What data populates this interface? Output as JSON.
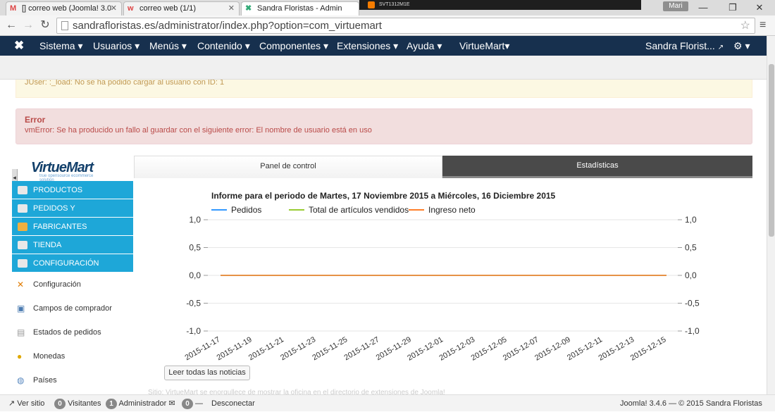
{
  "browser": {
    "tabs": [
      {
        "label": "[] correo web (Joomla! 3.0",
        "icon": "gmail-icon"
      },
      {
        "label": "correo web (1/1)",
        "icon": "webmail-icon"
      },
      {
        "label": "Sandra Floristas - Admin",
        "icon": "joomla-icon"
      }
    ],
    "taskbar_label": "SVT1312M1E",
    "profile": "Mari",
    "url": "sandrafloristas.es/administrator/index.php?option=com_virtuemart"
  },
  "joomla_bar": {
    "logo": "joomla-logo",
    "menu": [
      "Sistema",
      "Usuarios",
      "Menús",
      "Contenido",
      "Componentes",
      "Extensiones",
      "Ayuda",
      "VirtueMart"
    ],
    "site": "Sandra Florist...",
    "settings": "gear-icon"
  },
  "messages": {
    "warning_text": "JUser: :_load: No se ha podido cargar al usuario con ID: 1",
    "error_title": "Error",
    "error_text": "vmError: Se ha producido un fallo al guardar con el siguiente error: El nombre de usuario está en uso"
  },
  "sidebar": {
    "logo": "VirtueMart",
    "logo_tag": "true opensource ecommerce solution",
    "sections": [
      {
        "label": "PRODUCTOS",
        "icon": "products-icon"
      },
      {
        "label": "PEDIDOS Y",
        "icon": "orders-icon"
      },
      {
        "label": "FABRICANTES",
        "icon": "wrench-icon"
      },
      {
        "label": "TIENDA",
        "icon": "shop-icon"
      },
      {
        "label": "CONFIGURACIÓN",
        "icon": "config-icon"
      }
    ],
    "sub_items": [
      {
        "label": "Configuración",
        "icon": "tools-icon"
      },
      {
        "label": "Campos de comprador",
        "icon": "fields-icon"
      },
      {
        "label": "Estados de pedidos",
        "icon": "document-icon"
      },
      {
        "label": "Monedas",
        "icon": "coins-icon"
      },
      {
        "label": "Países",
        "icon": "globe-icon"
      }
    ]
  },
  "panel": {
    "tabs": [
      "Panel de control",
      "Estadísticas"
    ],
    "news_button": "Leer todas las noticias",
    "faint_text": "Sitio: VirtueMart se enorgullece de mostrar la oficina en el directorio de extensiones de Joomla!"
  },
  "chart_data": {
    "type": "line",
    "title": "Informe para el periodo de Martes, 17 Noviembre 2015 a Miércoles, 16 Diciembre 2015",
    "x": [
      "2015-11-17",
      "2015-11-19",
      "2015-11-21",
      "2015-11-23",
      "2015-11-25",
      "2015-11-27",
      "2015-11-29",
      "2015-12-01",
      "2015-12-03",
      "2015-12-05",
      "2015-12-07",
      "2015-12-09",
      "2015-12-11",
      "2015-12-13",
      "2015-12-15"
    ],
    "series": [
      {
        "name": "Pedidos",
        "color": "#3399ff",
        "values": [
          0,
          0,
          0,
          0,
          0,
          0,
          0,
          0,
          0,
          0,
          0,
          0,
          0,
          0,
          0
        ]
      },
      {
        "name": "Total de artículos vendidos",
        "color": "#99cc33",
        "values": [
          0,
          0,
          0,
          0,
          0,
          0,
          0,
          0,
          0,
          0,
          0,
          0,
          0,
          0,
          0
        ]
      },
      {
        "name": "Ingreso neto",
        "color": "#ff7f2a",
        "values": [
          0,
          0,
          0,
          0,
          0,
          0,
          0,
          0,
          0,
          0,
          0,
          0,
          0,
          0,
          0
        ]
      }
    ],
    "y_ticks": [
      "1,0",
      "0,5",
      "0,0",
      "-0,5",
      "-1,0"
    ],
    "ylim": [
      -1,
      1
    ],
    "grid": true,
    "legend": "top-left"
  },
  "status_bar": {
    "view_site": "Ver sitio",
    "visitors_count": "0",
    "visitors_label": "Visitantes",
    "admins_count": "1",
    "admins_label": "Administrador",
    "messages_count": "0",
    "logout": "Desconectar",
    "footer": "Joomla! 3.4.6 — © 2015 Sandra Floristas"
  }
}
